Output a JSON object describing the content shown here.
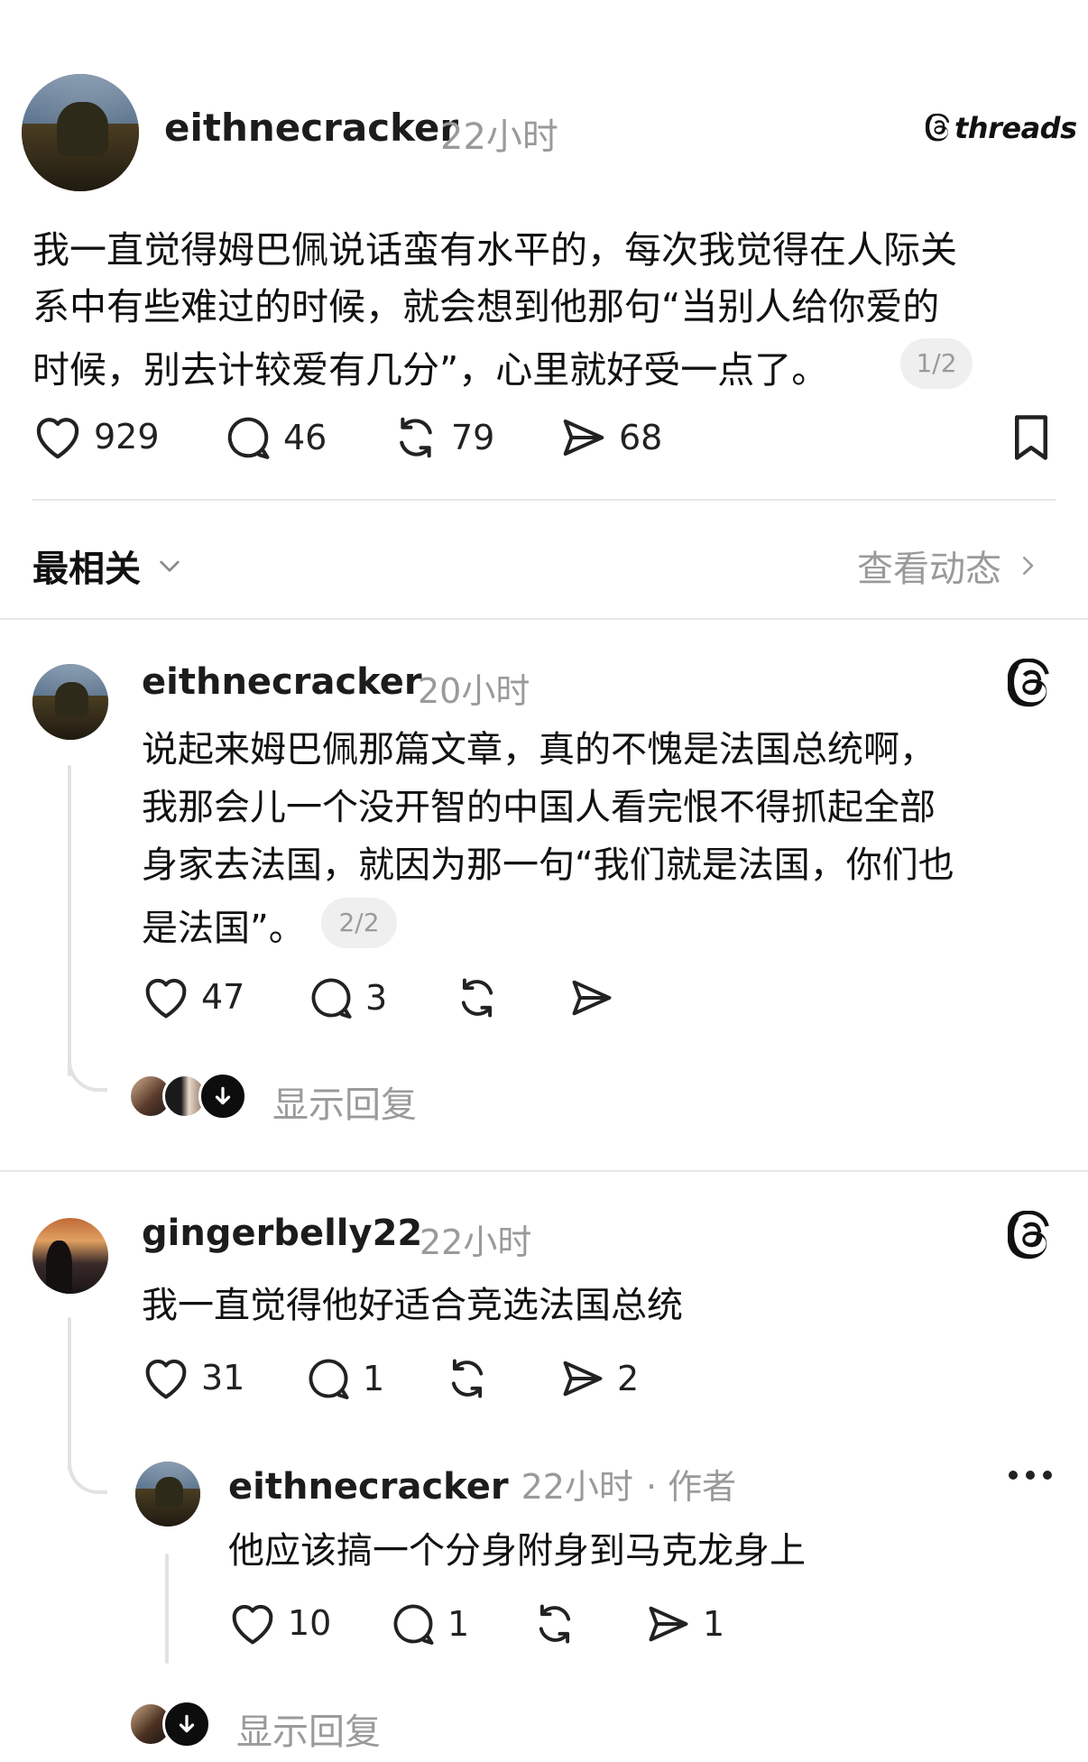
{
  "main_post": {
    "username": "eithnecracker",
    "time": "22小时",
    "brand": "threads",
    "text_lines": [
      "我一直觉得姆巴佩说话蛮有水平的，每次我觉得在人际关",
      "系中有些难过的时候，就会想到他那句“当别人给你爱的",
      "时候，别去计较爱有几分”，心里就好受一点了。"
    ],
    "page_badge": "1/2",
    "likes": "929",
    "comments": "46",
    "reposts": "79",
    "shares": "68"
  },
  "sort_bar": {
    "label": "最相关",
    "view_activity": "查看动态"
  },
  "reply1": {
    "username": "eithnecracker",
    "time": "20小时",
    "text_lines": [
      "说起来姆巴佩那篇文章，真的不愧是法国总统啊，",
      "我那会儿一个没开智的中国人看完恨不得抓起全部",
      "身家去法国，就因为那一句“我们就是法国，你们也",
      "是法国”。"
    ],
    "page_badge": "2/2",
    "likes": "47",
    "comments": "3",
    "show_replies": "显示回复"
  },
  "reply2": {
    "username": "gingerbelly22",
    "time": "22小时",
    "text": "我一直觉得他好适合竞选法国总统",
    "likes": "31",
    "comments": "1",
    "shares": "2"
  },
  "reply3": {
    "username": "eithnecracker",
    "time": "22小时",
    "author_tag": "· 作者",
    "text": "他应该搞一个分身附身到马克龙身上",
    "likes": "10",
    "comments": "1",
    "shares": "1",
    "show_replies": "显示回复"
  },
  "colors": {
    "text": "#111111",
    "muted": "#9a9a9a",
    "divider": "#e6e6e6"
  }
}
